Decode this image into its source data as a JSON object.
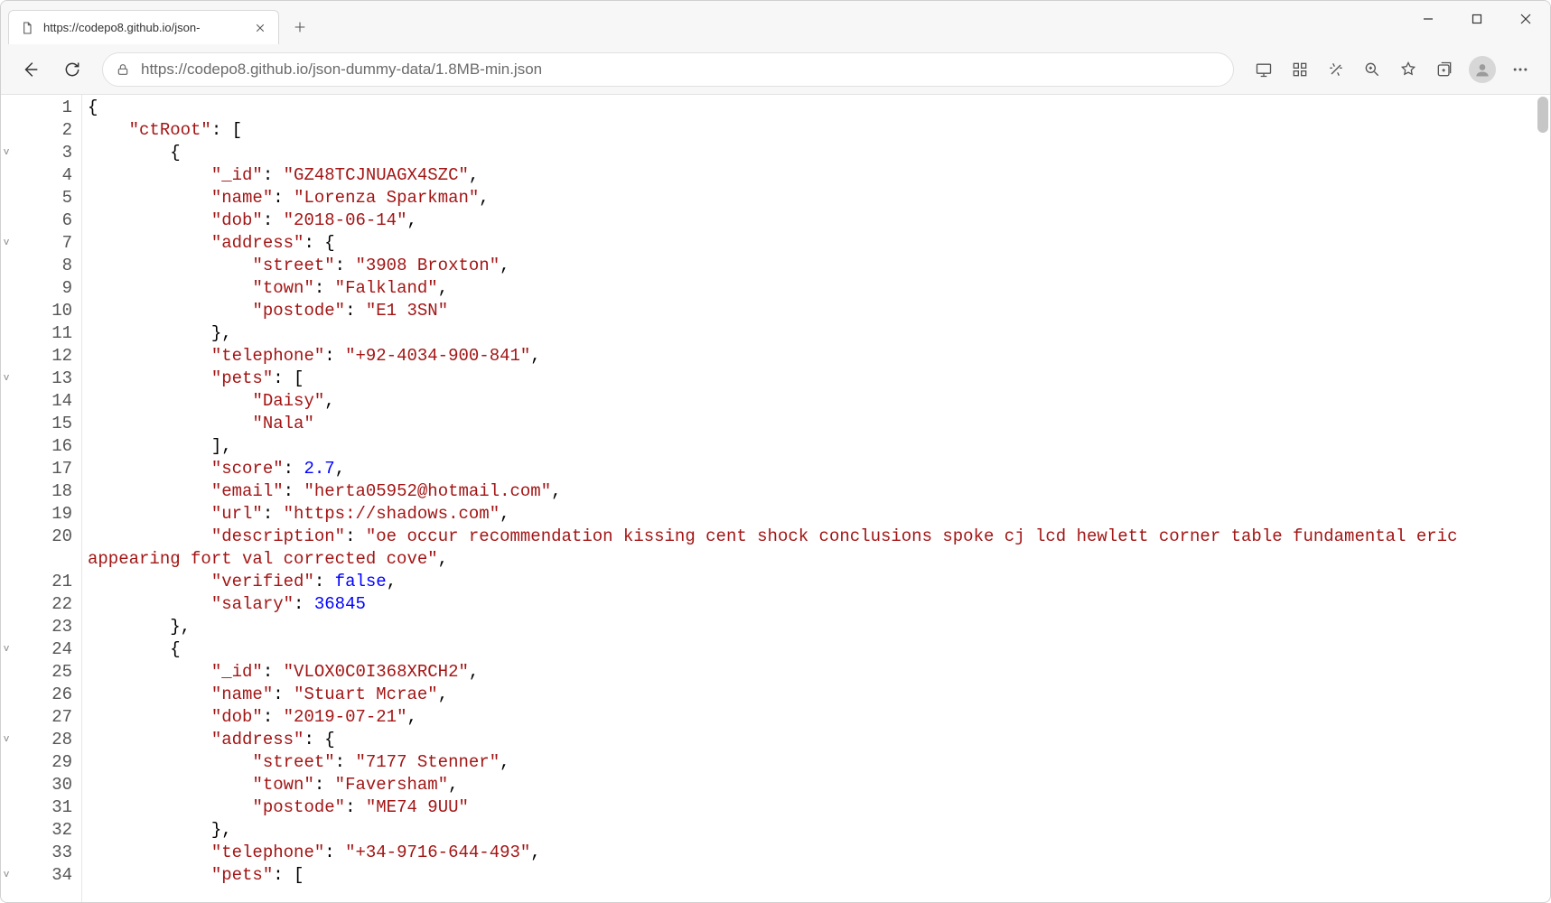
{
  "tab": {
    "title": "https://codepo8.github.io/json-"
  },
  "url": "https://codepo8.github.io/json-dummy-data/1.8MB-min.json",
  "fold_marks": {
    "3": "v",
    "7": "v",
    "13": "v",
    "24": "v",
    "28": "v",
    "34": "v"
  },
  "code_lines": [
    {
      "n": 1,
      "indent": 0,
      "tokens": [
        {
          "t": "plain",
          "v": "{"
        }
      ]
    },
    {
      "n": 2,
      "indent": 4,
      "tokens": [
        {
          "t": "str",
          "v": "\"ctRoot\""
        },
        {
          "t": "plain",
          "v": ": ["
        }
      ]
    },
    {
      "n": 3,
      "indent": 8,
      "tokens": [
        {
          "t": "plain",
          "v": "{"
        }
      ]
    },
    {
      "n": 4,
      "indent": 12,
      "tokens": [
        {
          "t": "str",
          "v": "\"_id\""
        },
        {
          "t": "plain",
          "v": ": "
        },
        {
          "t": "str",
          "v": "\"GZ48TCJNUAGX4SZC\""
        },
        {
          "t": "plain",
          "v": ","
        }
      ]
    },
    {
      "n": 5,
      "indent": 12,
      "tokens": [
        {
          "t": "str",
          "v": "\"name\""
        },
        {
          "t": "plain",
          "v": ": "
        },
        {
          "t": "str",
          "v": "\"Lorenza Sparkman\""
        },
        {
          "t": "plain",
          "v": ","
        }
      ]
    },
    {
      "n": 6,
      "indent": 12,
      "tokens": [
        {
          "t": "str",
          "v": "\"dob\""
        },
        {
          "t": "plain",
          "v": ": "
        },
        {
          "t": "str",
          "v": "\"2018-06-14\""
        },
        {
          "t": "plain",
          "v": ","
        }
      ]
    },
    {
      "n": 7,
      "indent": 12,
      "tokens": [
        {
          "t": "str",
          "v": "\"address\""
        },
        {
          "t": "plain",
          "v": ": {"
        }
      ]
    },
    {
      "n": 8,
      "indent": 16,
      "tokens": [
        {
          "t": "str",
          "v": "\"street\""
        },
        {
          "t": "plain",
          "v": ": "
        },
        {
          "t": "str",
          "v": "\"3908 Broxton\""
        },
        {
          "t": "plain",
          "v": ","
        }
      ]
    },
    {
      "n": 9,
      "indent": 16,
      "tokens": [
        {
          "t": "str",
          "v": "\"town\""
        },
        {
          "t": "plain",
          "v": ": "
        },
        {
          "t": "str",
          "v": "\"Falkland\""
        },
        {
          "t": "plain",
          "v": ","
        }
      ]
    },
    {
      "n": 10,
      "indent": 16,
      "tokens": [
        {
          "t": "str",
          "v": "\"postode\""
        },
        {
          "t": "plain",
          "v": ": "
        },
        {
          "t": "str",
          "v": "\"E1 3SN\""
        }
      ]
    },
    {
      "n": 11,
      "indent": 12,
      "tokens": [
        {
          "t": "plain",
          "v": "},"
        }
      ]
    },
    {
      "n": 12,
      "indent": 12,
      "tokens": [
        {
          "t": "str",
          "v": "\"telephone\""
        },
        {
          "t": "plain",
          "v": ": "
        },
        {
          "t": "str",
          "v": "\"+92-4034-900-841\""
        },
        {
          "t": "plain",
          "v": ","
        }
      ]
    },
    {
      "n": 13,
      "indent": 12,
      "tokens": [
        {
          "t": "str",
          "v": "\"pets\""
        },
        {
          "t": "plain",
          "v": ": ["
        }
      ]
    },
    {
      "n": 14,
      "indent": 16,
      "tokens": [
        {
          "t": "str",
          "v": "\"Daisy\""
        },
        {
          "t": "plain",
          "v": ","
        }
      ]
    },
    {
      "n": 15,
      "indent": 16,
      "tokens": [
        {
          "t": "str",
          "v": "\"Nala\""
        }
      ]
    },
    {
      "n": 16,
      "indent": 12,
      "tokens": [
        {
          "t": "plain",
          "v": "],"
        }
      ]
    },
    {
      "n": 17,
      "indent": 12,
      "tokens": [
        {
          "t": "str",
          "v": "\"score\""
        },
        {
          "t": "plain",
          "v": ": "
        },
        {
          "t": "num",
          "v": "2.7"
        },
        {
          "t": "plain",
          "v": ","
        }
      ]
    },
    {
      "n": 18,
      "indent": 12,
      "tokens": [
        {
          "t": "str",
          "v": "\"email\""
        },
        {
          "t": "plain",
          "v": ": "
        },
        {
          "t": "str",
          "v": "\"herta05952@hotmail.com\""
        },
        {
          "t": "plain",
          "v": ","
        }
      ]
    },
    {
      "n": 19,
      "indent": 12,
      "tokens": [
        {
          "t": "str",
          "v": "\"url\""
        },
        {
          "t": "plain",
          "v": ": "
        },
        {
          "t": "str",
          "v": "\"https://shadows.com\""
        },
        {
          "t": "plain",
          "v": ","
        }
      ]
    },
    {
      "n": 20,
      "indent": 12,
      "wrap": true,
      "tokens": [
        {
          "t": "str",
          "v": "\"description\""
        },
        {
          "t": "plain",
          "v": ": "
        },
        {
          "t": "str",
          "v": "\"oe occur recommendation kissing cent shock conclusions spoke cj lcd hewlett corner table fundamental eric appearing fort val corrected cove\""
        },
        {
          "t": "plain",
          "v": ","
        }
      ]
    },
    {
      "n": 21,
      "indent": 12,
      "tokens": [
        {
          "t": "str",
          "v": "\"verified\""
        },
        {
          "t": "plain",
          "v": ": "
        },
        {
          "t": "bool",
          "v": "false"
        },
        {
          "t": "plain",
          "v": ","
        }
      ]
    },
    {
      "n": 22,
      "indent": 12,
      "tokens": [
        {
          "t": "str",
          "v": "\"salary\""
        },
        {
          "t": "plain",
          "v": ": "
        },
        {
          "t": "num",
          "v": "36845"
        }
      ]
    },
    {
      "n": 23,
      "indent": 8,
      "tokens": [
        {
          "t": "plain",
          "v": "},"
        }
      ]
    },
    {
      "n": 24,
      "indent": 8,
      "tokens": [
        {
          "t": "plain",
          "v": "{"
        }
      ]
    },
    {
      "n": 25,
      "indent": 12,
      "tokens": [
        {
          "t": "str",
          "v": "\"_id\""
        },
        {
          "t": "plain",
          "v": ": "
        },
        {
          "t": "str",
          "v": "\"VLOX0C0I368XRCH2\""
        },
        {
          "t": "plain",
          "v": ","
        }
      ]
    },
    {
      "n": 26,
      "indent": 12,
      "tokens": [
        {
          "t": "str",
          "v": "\"name\""
        },
        {
          "t": "plain",
          "v": ": "
        },
        {
          "t": "str",
          "v": "\"Stuart Mcrae\""
        },
        {
          "t": "plain",
          "v": ","
        }
      ]
    },
    {
      "n": 27,
      "indent": 12,
      "tokens": [
        {
          "t": "str",
          "v": "\"dob\""
        },
        {
          "t": "plain",
          "v": ": "
        },
        {
          "t": "str",
          "v": "\"2019-07-21\""
        },
        {
          "t": "plain",
          "v": ","
        }
      ]
    },
    {
      "n": 28,
      "indent": 12,
      "tokens": [
        {
          "t": "str",
          "v": "\"address\""
        },
        {
          "t": "plain",
          "v": ": {"
        }
      ]
    },
    {
      "n": 29,
      "indent": 16,
      "tokens": [
        {
          "t": "str",
          "v": "\"street\""
        },
        {
          "t": "plain",
          "v": ": "
        },
        {
          "t": "str",
          "v": "\"7177 Stenner\""
        },
        {
          "t": "plain",
          "v": ","
        }
      ]
    },
    {
      "n": 30,
      "indent": 16,
      "tokens": [
        {
          "t": "str",
          "v": "\"town\""
        },
        {
          "t": "plain",
          "v": ": "
        },
        {
          "t": "str",
          "v": "\"Faversham\""
        },
        {
          "t": "plain",
          "v": ","
        }
      ]
    },
    {
      "n": 31,
      "indent": 16,
      "tokens": [
        {
          "t": "str",
          "v": "\"postode\""
        },
        {
          "t": "plain",
          "v": ": "
        },
        {
          "t": "str",
          "v": "\"ME74 9UU\""
        }
      ]
    },
    {
      "n": 32,
      "indent": 12,
      "tokens": [
        {
          "t": "plain",
          "v": "},"
        }
      ]
    },
    {
      "n": 33,
      "indent": 12,
      "tokens": [
        {
          "t": "str",
          "v": "\"telephone\""
        },
        {
          "t": "plain",
          "v": ": "
        },
        {
          "t": "str",
          "v": "\"+34-9716-644-493\""
        },
        {
          "t": "plain",
          "v": ","
        }
      ]
    },
    {
      "n": 34,
      "indent": 12,
      "tokens": [
        {
          "t": "str",
          "v": "\"pets\""
        },
        {
          "t": "plain",
          "v": ": ["
        }
      ]
    }
  ]
}
